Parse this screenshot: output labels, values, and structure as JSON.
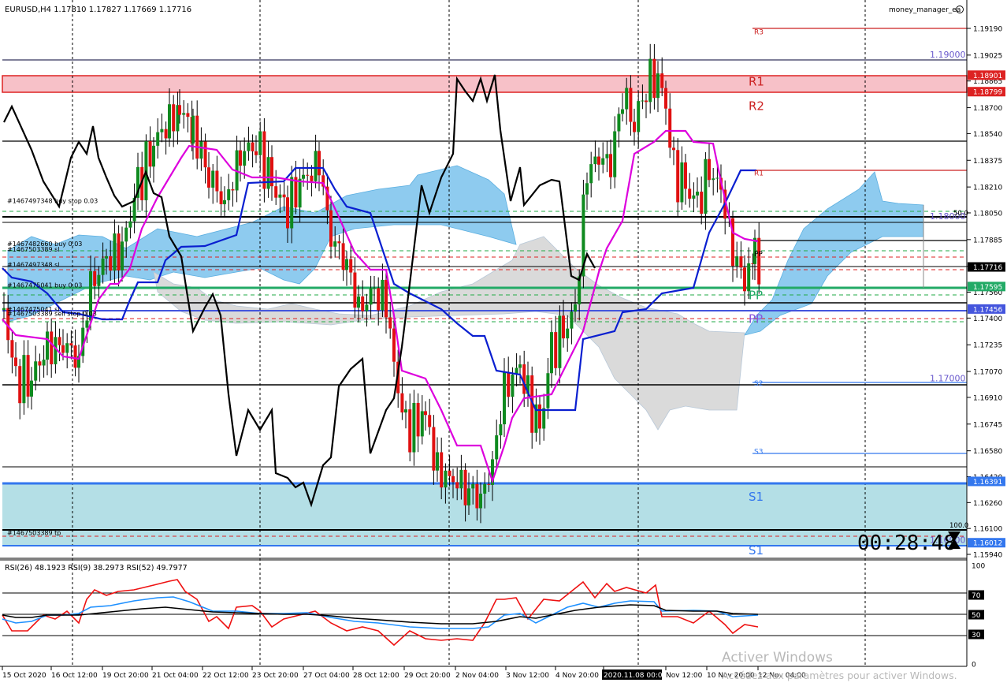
{
  "header": {
    "symbol_info": "EURUSD,H4  1.17810 1.17827 1.17669 1.17716",
    "ea_name": "money_manager_ea"
  },
  "rsi_header": "RSI(26) 48.1923  RSI(9) 38.2973  RSI(52) 49.7977",
  "countdown": "00:28:48",
  "chart_data": {
    "type": "candlestick",
    "symbol": "EURUSD",
    "timeframe": "H4",
    "price_axis": {
      "range": [
        1.159,
        1.1925
      ],
      "ticks": [
        "1.19190",
        "1.19025",
        "1.18865",
        "1.18700",
        "1.18540",
        "1.18375",
        "1.18210",
        "1.18050",
        "1.17885",
        "1.17720",
        "1.17560",
        "1.17400",
        "1.17235",
        "1.17070",
        "1.16910",
        "1.16745",
        "1.16580",
        "1.16420",
        "1.16260",
        "1.16100",
        "1.15940"
      ]
    },
    "time_axis_labels": [
      "15 Oct 2020",
      "16 Oct 12:00",
      "19 Oct 20:00",
      "21 Oct 04:00",
      "22 Oct 12:00",
      "23 Oct 20:00",
      "27 Oct 04:00",
      "28 Oct 12:00",
      "29 Oct 20:00",
      "2 Nov 04:00",
      "3 Nov 12:00",
      "4 Nov 20:00",
      "2020.11.08 00:00",
      "Nov 12:00",
      "10 Nov 20:00",
      "12 Nov 04:00"
    ],
    "price_tags": [
      {
        "text": "1.18901",
        "color": "#dd2222"
      },
      {
        "text": "1.18799",
        "color": "#dd2222"
      },
      {
        "text": "1.17716",
        "color": "#000000"
      },
      {
        "text": "1.17595",
        "color": "#22aa66"
      },
      {
        "text": "1.17456",
        "color": "#4455dd"
      },
      {
        "text": "1.16391",
        "color": "#3377ee"
      },
      {
        "text": "1.16012",
        "color": "#3377ee"
      }
    ],
    "level_labels": [
      {
        "text": "R3",
        "price": 1.1917,
        "color": "#cc2222"
      },
      {
        "text": "R1",
        "price": 1.18865,
        "color": "#cc2222"
      },
      {
        "text": "R2",
        "price": 1.18715,
        "color": "#cc2222"
      },
      {
        "text": "R1",
        "price": 1.183,
        "color": "#cc2222"
      },
      {
        "text": "PP",
        "price": 1.178,
        "color": "#000000"
      },
      {
        "text": "PP",
        "price": 1.17545,
        "color": "#22aa66"
      },
      {
        "text": "PP",
        "price": 1.174,
        "color": "#8855dd"
      },
      {
        "text": "S2",
        "price": 1.17,
        "color": "#3377ee"
      },
      {
        "text": "S3",
        "price": 1.1658,
        "color": "#3377ee"
      },
      {
        "text": "S1",
        "price": 1.163,
        "color": "#3377ee"
      },
      {
        "text": "S1",
        "price": 1.1597,
        "color": "#3377ee"
      }
    ],
    "round_levels": [
      {
        "text": "1.19000",
        "price": 1.19
      },
      {
        "text": "1.18000",
        "price": 1.18
      },
      {
        "text": "1.17000",
        "price": 1.17
      },
      {
        "text": "1.16000",
        "price": 1.16
      }
    ],
    "order_labels": [
      {
        "text": "#1467497348 buy stop 0.03",
        "price": 1.1811
      },
      {
        "text": "#1467482660 buy 0.03",
        "price": 1.17845
      },
      {
        "text": "#1467503389 sl",
        "price": 1.1781
      },
      {
        "text": "#1467497348 sl",
        "price": 1.17715
      },
      {
        "text": "#1467475041 buy 0.03",
        "price": 1.1759
      },
      {
        "text": "#1467475041 sl",
        "price": 1.1744
      },
      {
        "text": "#1467503389 sell stop 0.03",
        "price": 1.17415
      },
      {
        "text": "#1467503389 tp",
        "price": 1.1606
      }
    ],
    "misc_labels": {
      "fifty": "50.0",
      "hundred": "100.0"
    },
    "rsi_axis_ticks": [
      "100",
      "70",
      "50",
      "30",
      "0"
    ],
    "rsi_levels": [
      70,
      50,
      30
    ]
  },
  "watermark": {
    "title": "Activer Windows",
    "subtitle": "Accédez aux paramètres pour activer Windows."
  }
}
